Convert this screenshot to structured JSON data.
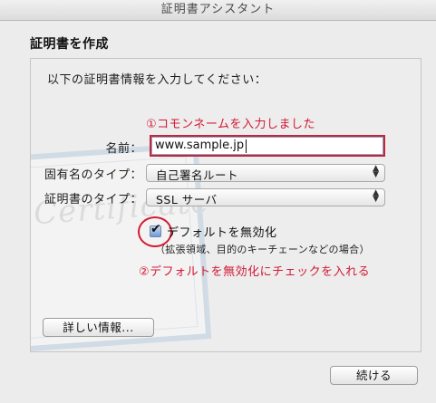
{
  "window": {
    "title": "証明書アシスタント"
  },
  "page": {
    "heading": "証明書を作成",
    "prompt": "以下の証明書情報を入力してください："
  },
  "annotations": {
    "step1": "①コモンネームを入力しました",
    "step2": "②デフォルトを無効化にチェックを入れる"
  },
  "form": {
    "name_label": "名前：",
    "name_value": "www.sample.jp",
    "identity_type_label": "固有名のタイプ：",
    "identity_type_value": "自己署名ルート",
    "cert_type_label": "証明書のタイプ：",
    "cert_type_value": "SSL サーバ",
    "override_defaults_label": "デフォルトを無効化",
    "override_defaults_checked": true,
    "override_defaults_sub": "（拡張領域、目的のキーチェーンなどの場合）"
  },
  "buttons": {
    "details": "詳しい情報...",
    "continue": "続ける"
  },
  "colors": {
    "annotation": "#d41a35",
    "focus_border": "#c7243a"
  }
}
